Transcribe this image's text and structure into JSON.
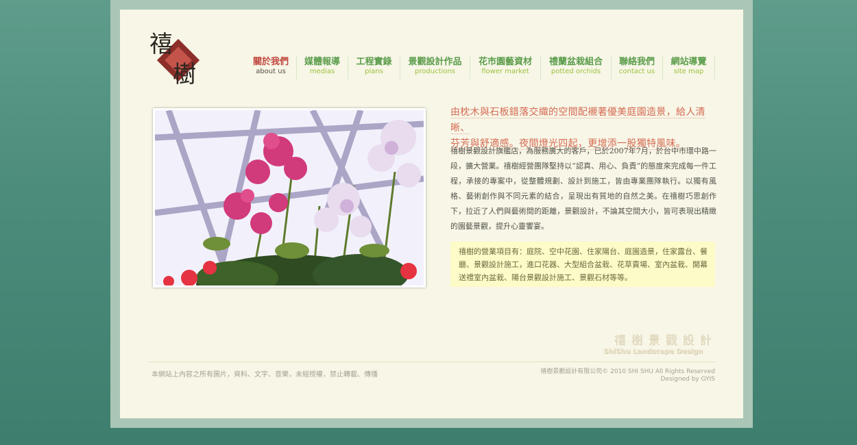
{
  "logo": {
    "glyph_top": "禧",
    "glyph_bottom": "樹"
  },
  "nav": {
    "items": [
      {
        "zh": "關於我們",
        "en": "about us",
        "active": true
      },
      {
        "zh": "媒體報導",
        "en": "medias",
        "active": false
      },
      {
        "zh": "工程實錄",
        "en": "plans",
        "active": false
      },
      {
        "zh": "景觀設計作品",
        "en": "productions",
        "active": false
      },
      {
        "zh": "花市園藝資材",
        "en": "flower market",
        "active": false
      },
      {
        "zh": "禮蘭盆栽組合",
        "en": "potted orchids",
        "active": false
      },
      {
        "zh": "聯絡我們",
        "en": "contact us",
        "active": false
      },
      {
        "zh": "網站導覽",
        "en": "site map",
        "active": false
      }
    ]
  },
  "main": {
    "headline_line1": "由枕木與石板錯落交織的空間配襯著優美庭園造景，給人清晰、",
    "headline_line2": "芬芳與舒適感。夜間燈光四起，更增添一股獨特風味。",
    "body": "禧樹景觀設計旗艦店，為服務廣大的客戶，已於2007年7月，於台中市環中路一段，擴大營業。禧樹經營團隊堅持以”認真、用心、負責”的態度來完成每一件工程，承接的專案中，從整體規劃、設計到施工，皆由專業團隊執行。以獨有風格、藝術創作與不同元素的結合，呈現出有質地的自然之美。在禧樹巧思創作下，拉近了人們與藝術間的距離，景觀設計，不論其空間大小，皆可表現出精緻的園藝景觀，提升心靈饗宴。",
    "services": "禧樹的營業項目有：庭院、空中花園、住家陽台、庭園造景，住家露台、餐廳、景觀設計施工，進口花器、大型組合盆栽、花草賣場、室內盆栽、開幕送禮室內盆栽、陽台景觀設計施工、景觀石材等等。"
  },
  "brand": {
    "zh": "禧樹景觀設計",
    "en": "ShiShu Landscape Design"
  },
  "footer": {
    "copyright_notice": "本網站上內容之所有圖片，資料、文字、音樂，未經授權，禁止轉載、傳播",
    "company": "禧樹景觀設計有限公司© 2010 SHI SHU All Rights Reserved",
    "designer": "Designed by GYIS"
  },
  "colors": {
    "background": "#4d8d7c",
    "frame": "#aac6b6",
    "page": "#f7f6e7",
    "nav_green": "#5c9d4c",
    "nav_active": "#c0463c",
    "headline": "#d56b53",
    "services_bg": "#fdfbc8"
  }
}
